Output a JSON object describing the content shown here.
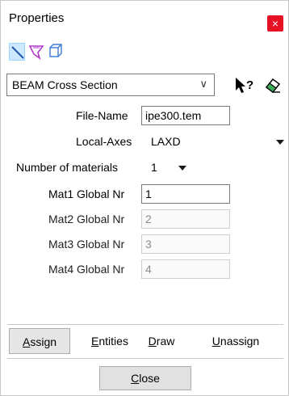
{
  "window": {
    "title": "Properties",
    "close_glyph": "×"
  },
  "toolbar_icons": [
    {
      "name": "line-select-icon"
    },
    {
      "name": "surface-select-icon"
    },
    {
      "name": "volume-select-icon"
    }
  ],
  "combo": {
    "value": "BEAM Cross Section",
    "arrow": "∨"
  },
  "side_buttons": {
    "help": "help-pointer-icon",
    "eraser": "eraser-icon"
  },
  "form": {
    "file_name": {
      "label": "File-Name",
      "value": "ipe300.tem"
    },
    "local_axes": {
      "label": "Local-Axes",
      "value": "LAXD"
    },
    "num_materials": {
      "label": "Number of materials",
      "value": "1"
    },
    "materials": [
      {
        "label": "Mat1 Global Nr",
        "value": "1",
        "enabled": true
      },
      {
        "label": "Mat2 Global Nr",
        "value": "2",
        "enabled": false
      },
      {
        "label": "Mat3 Global Nr",
        "value": "3",
        "enabled": false
      },
      {
        "label": "Mat4 Global Nr",
        "value": "4",
        "enabled": false
      }
    ]
  },
  "actions": {
    "assign": {
      "first": "A",
      "rest": "ssign"
    },
    "entities": {
      "first": "E",
      "rest": "ntities"
    },
    "draw": {
      "first": "D",
      "rest": "raw"
    },
    "unassign": {
      "first": "U",
      "rest": "nassign"
    }
  },
  "close": {
    "first": "C",
    "rest": "lose"
  },
  "colors": {
    "close_red": "#e81123",
    "selected_icon_bg": "#cde8ff",
    "icon_blue": "#1e5aa8",
    "icon_purple": "#b23cc8"
  }
}
